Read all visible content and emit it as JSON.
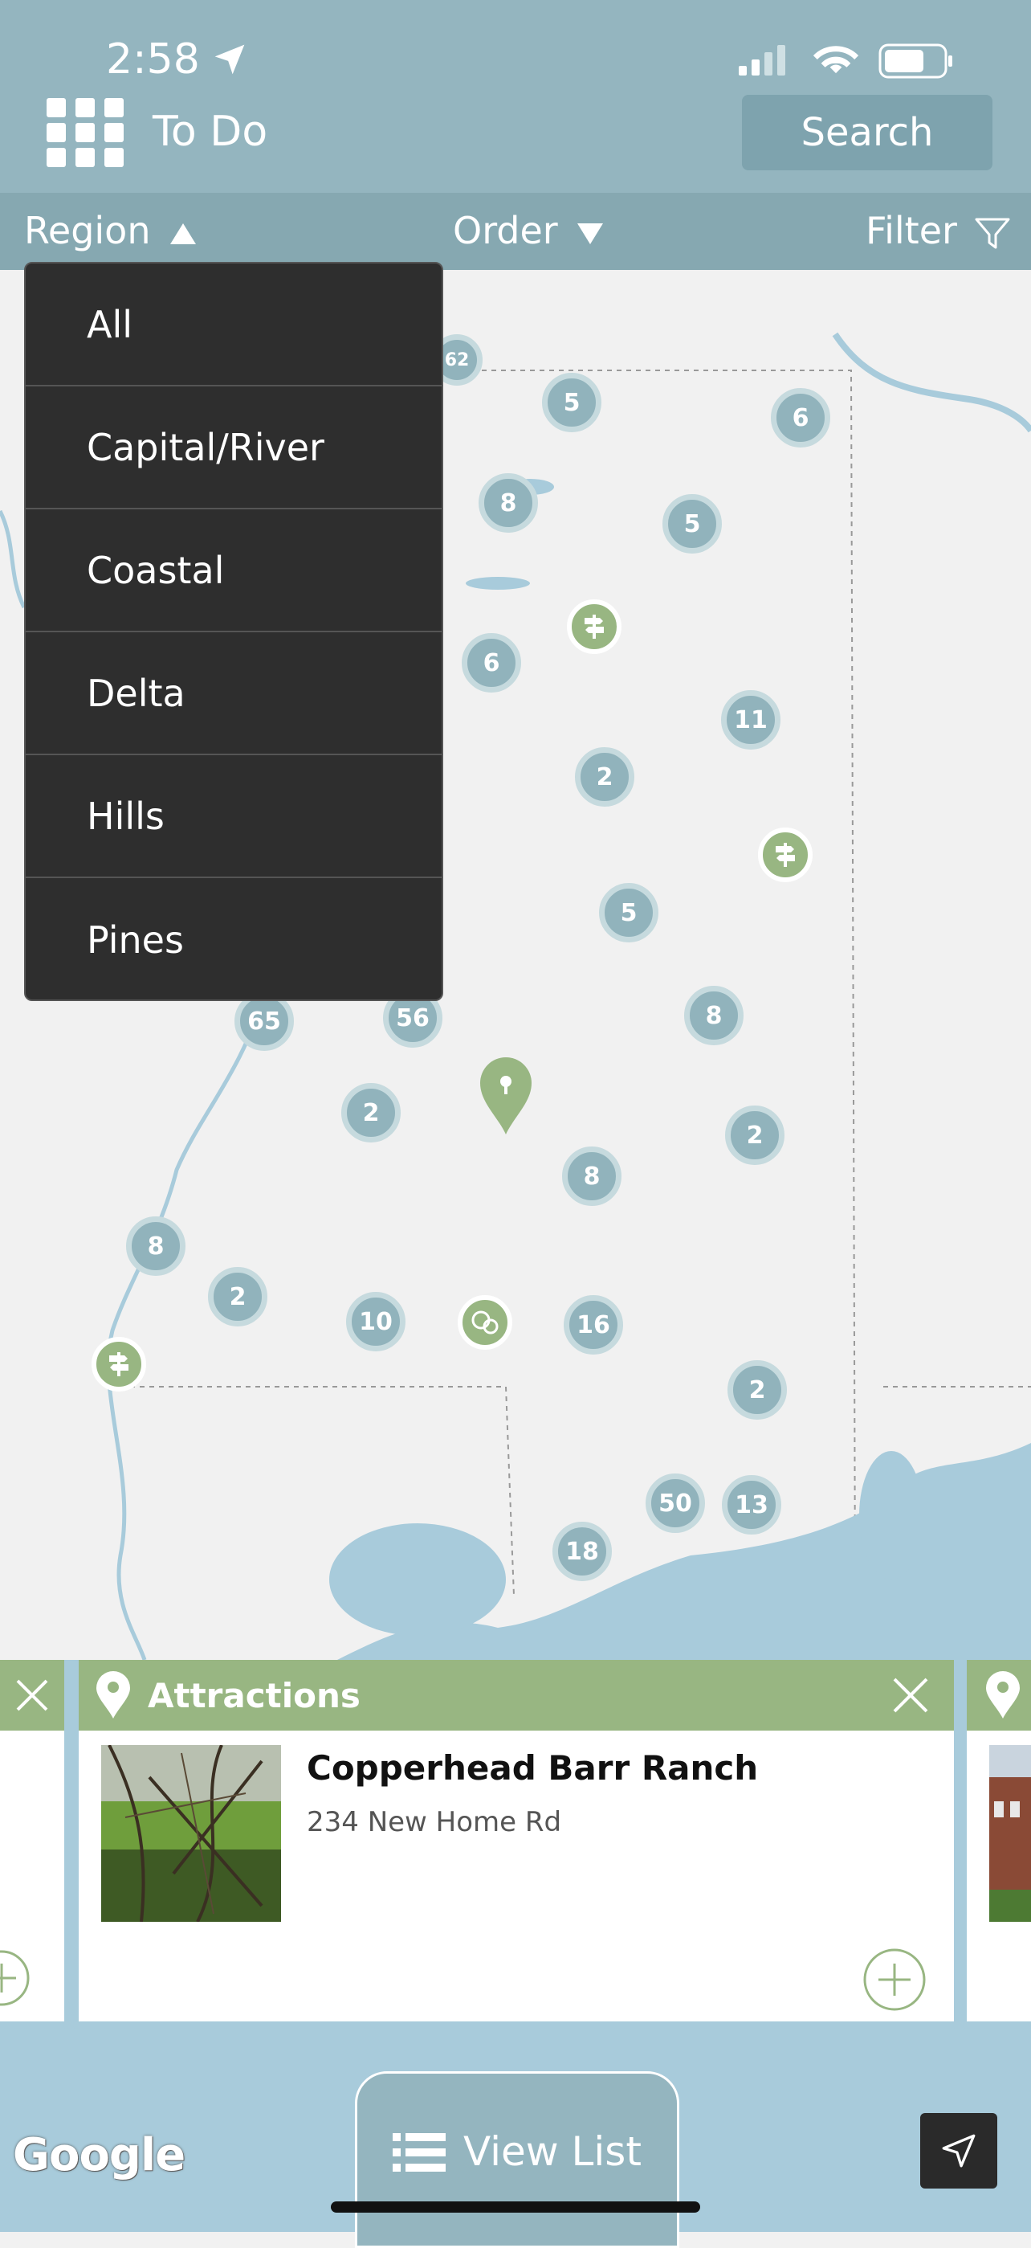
{
  "status": {
    "time": "2:58"
  },
  "header": {
    "title": "To Do",
    "search_label": "Search"
  },
  "toolbar": {
    "region_label": "Region",
    "order_label": "Order",
    "filter_label": "Filter"
  },
  "region_menu": {
    "items": [
      "All",
      "Capital/River",
      "Coastal",
      "Delta",
      "Hills",
      "Pines"
    ]
  },
  "map": {
    "clusters": [
      "62",
      "5",
      "6",
      "8",
      "5",
      "6",
      "11",
      "2",
      "5",
      "65",
      "56",
      "8",
      "2",
      "2",
      "8",
      "8",
      "2",
      "10",
      "16",
      "2",
      "50",
      "13",
      "18"
    ]
  },
  "cards": {
    "active": {
      "category": "Attractions",
      "name": "Copperhead Barr Ranch",
      "address": "234 New Home Rd"
    }
  },
  "bottom": {
    "view_list_label": "View List",
    "map_provider": "Google"
  },
  "colors": {
    "header": "#94b5bf",
    "accent_green": "#98b682",
    "water": "#a8cbdb",
    "menu_bg": "#2e2e2e"
  }
}
